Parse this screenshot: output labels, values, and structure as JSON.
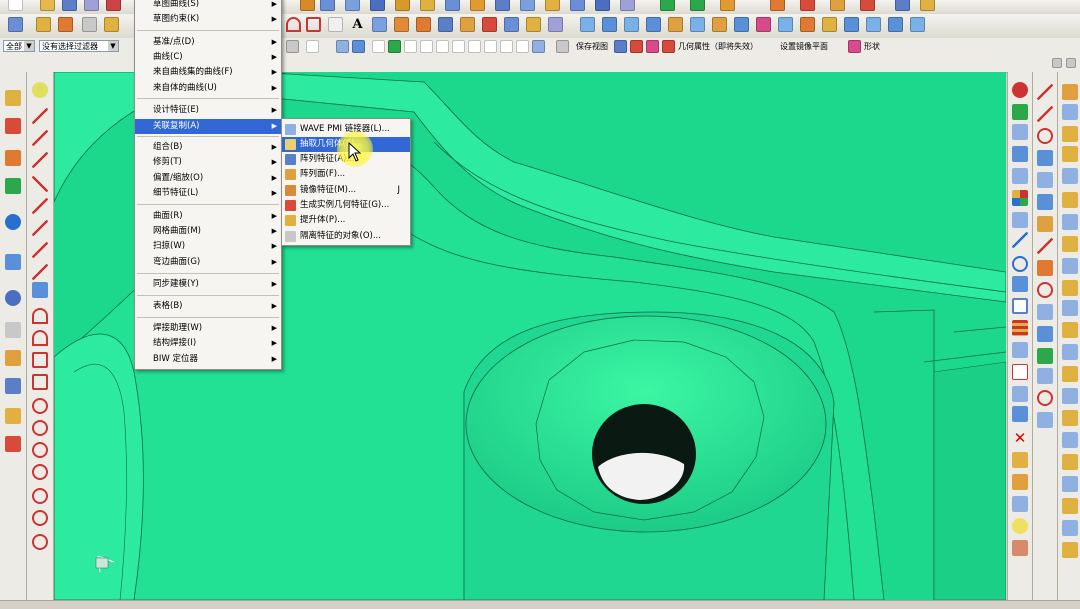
{
  "toolbar": {
    "selection_filter": "全部",
    "filter_value": "没有选择过滤器",
    "save_view": "保存视图",
    "geometry_props": "几何属性（即将失效）",
    "set_mirror_plane": "设置镜像平面",
    "shape": "形状"
  },
  "insert_menu": {
    "items": [
      {
        "label": "草图曲线(S)",
        "submenu": true
      },
      {
        "label": "草图约束(K)",
        "submenu": true
      },
      {
        "label": "基准/点(D)",
        "submenu": true
      },
      {
        "label": "曲线(C)",
        "submenu": true
      },
      {
        "label": "来自曲线集的曲线(F)",
        "submenu": true
      },
      {
        "label": "来自体的曲线(U)",
        "submenu": true
      },
      {
        "label": "设计特征(E)",
        "submenu": true
      },
      {
        "label": "关联复制(A)",
        "submenu": true
      },
      {
        "label": "组合(B)",
        "submenu": true
      },
      {
        "label": "修剪(T)",
        "submenu": true
      },
      {
        "label": "偏置/缩放(O)",
        "submenu": true
      },
      {
        "label": "细节特征(L)",
        "submenu": true
      },
      {
        "label": "曲面(R)",
        "submenu": true
      },
      {
        "label": "网格曲面(M)",
        "submenu": true
      },
      {
        "label": "扫掠(W)",
        "submenu": true
      },
      {
        "label": "弯边曲面(G)",
        "submenu": true
      },
      {
        "label": "同步建模(Y)",
        "submenu": true
      },
      {
        "label": "表格(B)",
        "submenu": true
      },
      {
        "label": "焊接助理(W)",
        "submenu": true
      },
      {
        "label": "结构焊接(I)",
        "submenu": true
      },
      {
        "label": "BIW 定位器",
        "submenu": true
      }
    ]
  },
  "assoc_copy_menu": {
    "items": [
      {
        "label": "WAVE PMI 链接器(L)..."
      },
      {
        "label": "抽取几何体(E)..."
      },
      {
        "label": "阵列特征(A)..."
      },
      {
        "label": "阵列面(F)..."
      },
      {
        "label": "镜像特征(M)...",
        "shortcut": "J"
      },
      {
        "label": "生成实例几何特征(G)..."
      },
      {
        "label": "提升体(P)..."
      },
      {
        "label": "隔离特征的对象(O)..."
      }
    ]
  },
  "colors": {
    "model": "#1dda8e",
    "menu_highlight": "#3168d5",
    "cursor_halo": "#fff550"
  }
}
